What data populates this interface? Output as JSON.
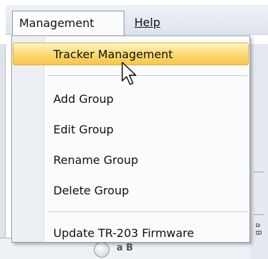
{
  "menubar": {
    "management_label": "Management",
    "help_label": "Help"
  },
  "dropdown": {
    "items": [
      {
        "label": "Tracker Management",
        "highlighted": true
      },
      {
        "label": "Add Group"
      },
      {
        "label": "Edit Group"
      },
      {
        "label": "Rename Group"
      },
      {
        "label": "Delete Group"
      },
      {
        "label": "Update TR-203 Firmware"
      }
    ]
  },
  "background_app": {
    "right_fragment": "a B",
    "bottom_fragment": "a B"
  },
  "colors": {
    "highlight": "#fbd86f",
    "highlight_border": "#e2ad2d",
    "menubar": "#dde4ee"
  },
  "icons": {
    "cursor": "arrow-cursor-icon"
  }
}
